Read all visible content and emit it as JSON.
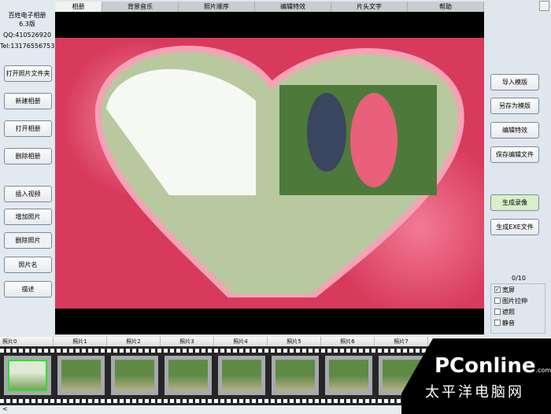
{
  "app": {
    "name": "百姓电子相册",
    "version": "6.3版",
    "qq": "QQ:410526920",
    "tel": "Tel:13176556753"
  },
  "tabs": [
    "相册",
    "背景音乐",
    "照片顺序",
    "编辑特效",
    "片头文字",
    "帮助"
  ],
  "left_buttons": [
    "打开照片文件夹",
    "新建相册",
    "打开相册",
    "删除相册",
    "插入视频",
    "增加照片",
    "删除照片",
    "照片名",
    "描述"
  ],
  "right_buttons": [
    "导入模版",
    "另存为模版",
    "编辑特效",
    "保存编辑文件",
    "生成录像",
    "生成EXE文件"
  ],
  "counter": "0/10",
  "options": [
    {
      "label": "宽屏",
      "checked": true
    },
    {
      "label": "图片拉伸",
      "checked": false
    },
    {
      "label": "遮照",
      "checked": false
    },
    {
      "label": "静音",
      "checked": false
    }
  ],
  "film_headers": [
    "照片0",
    "照片1",
    "照片2",
    "照片3",
    "照片4",
    "照片5",
    "照片6",
    "照片7"
  ],
  "scroll_left": "<",
  "watermark": {
    "brand": "PConline",
    "domain": ".com.cn",
    "cn": "太平洋电脑网"
  },
  "colors": {
    "selected_frame": "#2de02d",
    "accent_button": "#d8f0c8"
  }
}
